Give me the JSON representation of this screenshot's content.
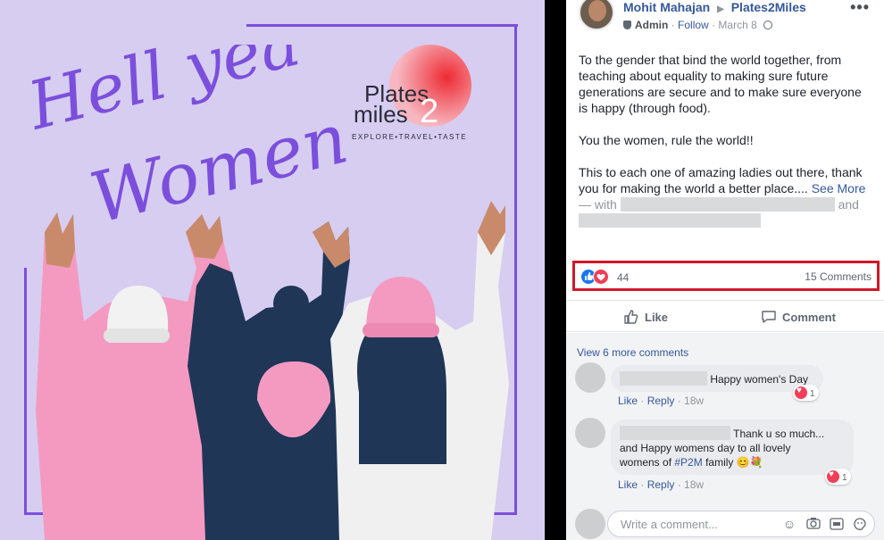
{
  "post": {
    "author": "Mohit Mahajan",
    "page": "Plates2Miles",
    "role": "Admin",
    "follow": "Follow",
    "date": "March 8",
    "body": [
      "To the gender that bind the world together, from teaching about equality to making sure future generations are secure and to make sure everyone is happy (through food).",
      "You the women, rule the world!!",
      "This to each one of amazing ladies out there, thank you for making the world a better place...."
    ],
    "see_more": "See More",
    "with_prefix": "— with",
    "with_and": "and"
  },
  "image": {
    "headline_line1": "Hell yea",
    "headline_line2": "Women!",
    "logo_line1": "Plates",
    "logo_line2": "miles",
    "logo_number": "2",
    "logo_tagline": "EXPLORE•TRAVEL•TASTE"
  },
  "reactions": {
    "count": "44",
    "comments": "15 Comments"
  },
  "actions": {
    "like": "Like",
    "comment": "Comment"
  },
  "comments": {
    "view_more": "View 6 more comments",
    "items": [
      {
        "text": "Happy women's Day",
        "like": "Like",
        "reply": "Reply",
        "age": "18w",
        "reactions": "1"
      },
      {
        "text_line1": "Thank u so much...",
        "text_line2": "and Happy womens day to all lovely",
        "text_line3_pre": "womens of",
        "hashtag": "#P2M",
        "text_line3_post": "family",
        "emoji": "😊💐",
        "like": "Like",
        "reply": "Reply",
        "age": "18w",
        "reactions": "1"
      }
    ]
  },
  "composer": {
    "placeholder": "Write a comment..."
  },
  "icons": {
    "more": "more-horizontal-icon",
    "like": "thumbs-up-icon",
    "comment": "speech-bubble-icon",
    "love": "heart-icon",
    "emoji": "smiley-icon",
    "camera": "camera-icon",
    "gif": "gif-icon",
    "sticker": "sticker-icon"
  },
  "colors": {
    "link": "#365899",
    "highlight_box": "#d0182b",
    "image_bg": "#d6cdf1",
    "headline": "#7b4fdc"
  }
}
